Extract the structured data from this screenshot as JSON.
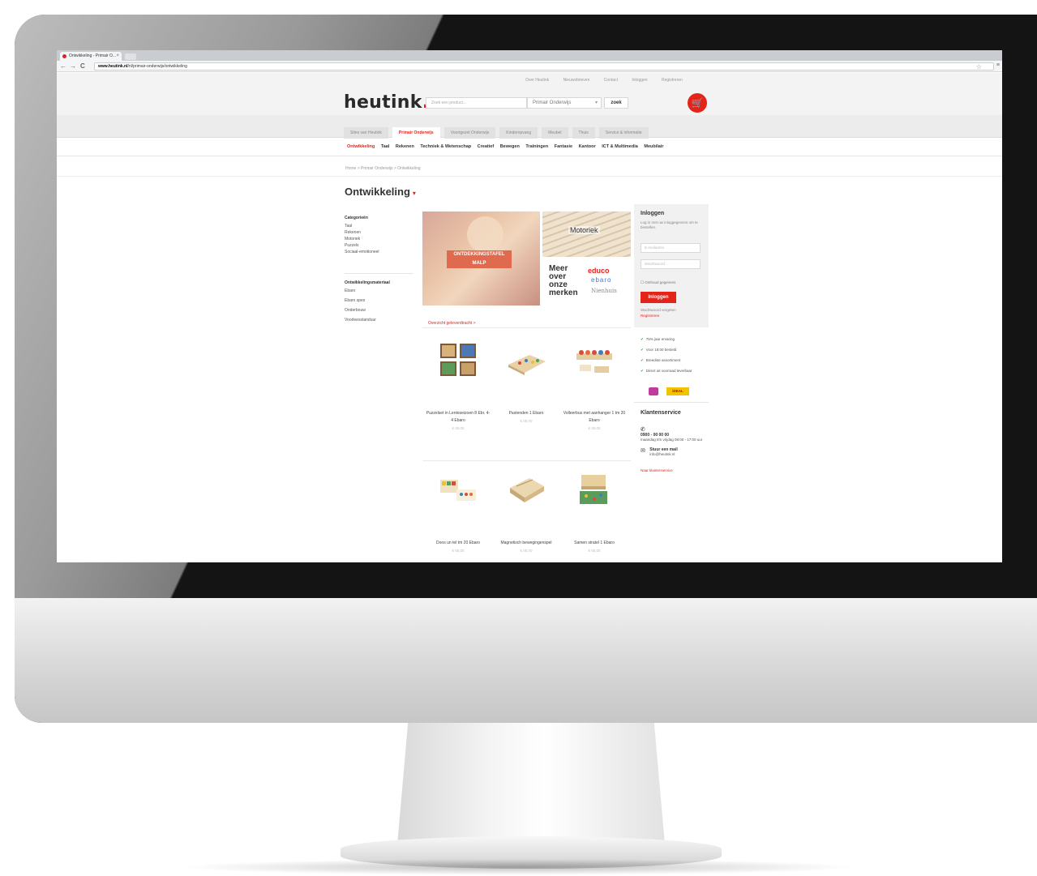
{
  "browser": {
    "tab_title": "Ontwikkeling - Primair O...",
    "tab_close": "×",
    "url_bold": "www.heutink.nl",
    "url_rest": "/nl/primair-onderwijs/ontwikkeling",
    "nav_back": "←",
    "nav_forward": "→",
    "nav_reload": "C",
    "star": "☆",
    "menu": "≡"
  },
  "header": {
    "top_links": [
      "Over Heutink",
      "Nieuwsbrieven",
      "Contact",
      "Inloggen",
      "Registreren"
    ],
    "logo": "heutink",
    "logo_dot": ".",
    "search_placeholder": "Zoek een product...",
    "scope": "Primair Onderwijs",
    "scope_chevron": "▾",
    "search_button": "zoek",
    "cart_icon": "🛒"
  },
  "category_tabs": [
    {
      "label": "Sites van Heutink",
      "active": false
    },
    {
      "label": "Primair Onderwijs",
      "active": true
    },
    {
      "label": "Voortgezet Onderwijs",
      "active": false
    },
    {
      "label": "Kinderopvang",
      "active": false
    },
    {
      "label": "Meubel",
      "active": false
    },
    {
      "label": "Thuis",
      "active": false
    },
    {
      "label": "Service & informatie",
      "active": false
    }
  ],
  "subnav": [
    {
      "label": "Ontwikkeling",
      "active": true
    },
    {
      "label": "Taal",
      "active": false
    },
    {
      "label": "Rekenen",
      "active": false
    },
    {
      "label": "Techniek & Wetenschap",
      "active": false
    },
    {
      "label": "Creatief",
      "active": false
    },
    {
      "label": "Bewegen",
      "active": false
    },
    {
      "label": "Trainingen",
      "active": false
    },
    {
      "label": "Fantasie",
      "active": false
    },
    {
      "label": "Kantoor",
      "active": false
    },
    {
      "label": "ICT & Multimedia",
      "active": false
    },
    {
      "label": "Meubilair",
      "active": false
    }
  ],
  "breadcrumb": "Home  >  Primair Onderwijs  >  Ontwikkeling",
  "page_title": "Ontwikkeling",
  "page_title_chevron": "▾",
  "sidebar": {
    "group1_title": "Categorieën",
    "group1_items": [
      "Taal",
      "Rekenen",
      "Motoriek",
      "Puzzels",
      "Sociaal-emotioneel"
    ],
    "group2_title": "Ontwikkelingsmateriaal",
    "group2_items": [
      "Ebaro",
      "Ebaro spes",
      "Onderbouw",
      "Voorleesstanduur"
    ]
  },
  "banner": {
    "left_tag_line1": "ONTDEKKINGSTAFEL",
    "left_tag_line2": "MALP",
    "top_right_label": "Motoriek",
    "meer_line1": "Meer",
    "meer_line2": "over",
    "meer_line3": "onze",
    "meer_line4": "merken",
    "brand1": "educo",
    "brand2": "ebaro",
    "brand3": "Nienhuis"
  },
  "products_link": "Overzicht geleverdtracht >",
  "products": [
    {
      "name": "Puzzelset in Lenteseizoen 8 Ebr. 4-4 Ebaro",
      "price": "€ 00,00"
    },
    {
      "name": "Pastenden 1 Ebaro",
      "price": "€ 00,00"
    },
    {
      "name": "Volleerbus met aanhanger 1 tm 20 Ebaro",
      "price": "€ 00,00"
    },
    {
      "name": "Doos un tel tm 20 Ebaro",
      "price": "€ 00,00"
    },
    {
      "name": "Magnetisch bewegingenspel",
      "price": "€ 00,00"
    },
    {
      "name": "Samen stratel 1 Ebaro",
      "price": "€ 00,00"
    }
  ],
  "login": {
    "title": "Inloggen",
    "subtitle": "Log in met uw inloggegevens om te bestellen.",
    "email_placeholder": "E-mailadres",
    "password_placeholder": "Wachtwoord",
    "remember": "Onthoud gegevens",
    "button": "Inloggen",
    "forgot": "Wachtwoord vergeten",
    "register": "Registreren"
  },
  "usps": [
    "75% jaar ervaring",
    "Voor 18:00 besteld",
    "Breedste assortiment",
    "Direct uit voorraad leverbaar"
  ],
  "usp_check": "✔",
  "payment_logo": "iDEAL",
  "customer_service": {
    "title": "Klantenservice",
    "phone_icon": "✆",
    "phone_title": "0900 - 00 00 00",
    "phone_sub": "maandag t/m vrijdag 08:00 - 17:00 uur",
    "mail_icon": "✉",
    "mail_title": "Stuur een mail",
    "mail_sub": "info@heutink.nl",
    "link": "Naar klantenservice"
  }
}
